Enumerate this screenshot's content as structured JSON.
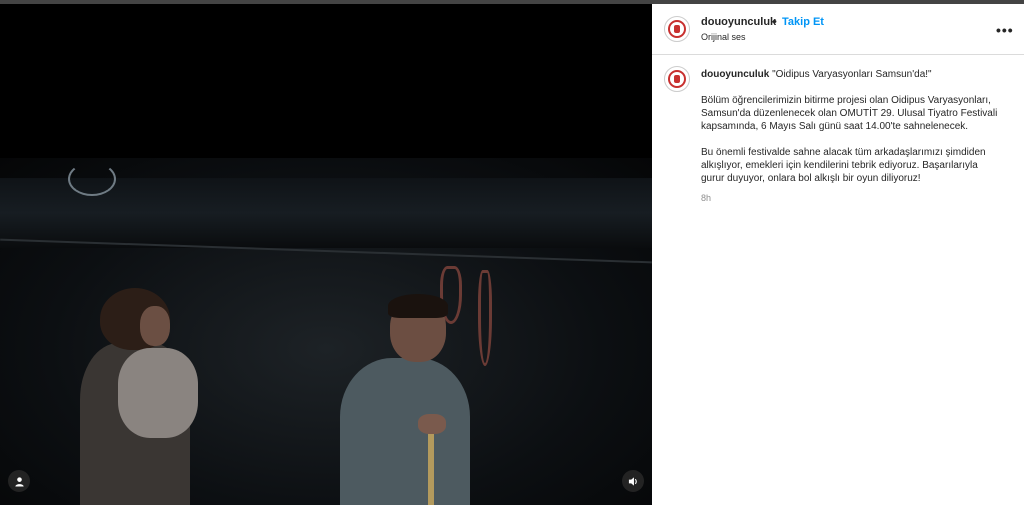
{
  "post": {
    "username": "douoyunculuk",
    "bullet": "•",
    "follow_label": "Takip Et",
    "audio_label": "Orijinal ses",
    "more_label": "•••"
  },
  "caption": {
    "username": "douoyunculuk",
    "title": "\"Oidipus Varyasyonları Samsun'da!\"",
    "paragraph1": "Bölüm öğrencilerimizin bitirme projesi olan Oidipus Varyasyonları, Samsun'da düzenlenecek olan OMUTİT 29. Ulusal Tiyatro Festivali kapsamında, 6 Mayıs Salı günü saat 14.00'te sahnelenecek.",
    "paragraph2": "Bu önemli festivalde sahne alacak tüm arkadaşlarımızı şimdiden alkışlıyor, emekleri için kendilerini tebrik ediyoruz. Başarılarıyla gurur duyuyor, onlara bol alkışlı bir oyun diliyoruz!",
    "time": "8h"
  },
  "video": {
    "user_tag_icon": "user-icon",
    "mute_icon": "speaker-icon"
  },
  "colors": {
    "follow": "#0095f6",
    "logo": "#c8302f"
  }
}
